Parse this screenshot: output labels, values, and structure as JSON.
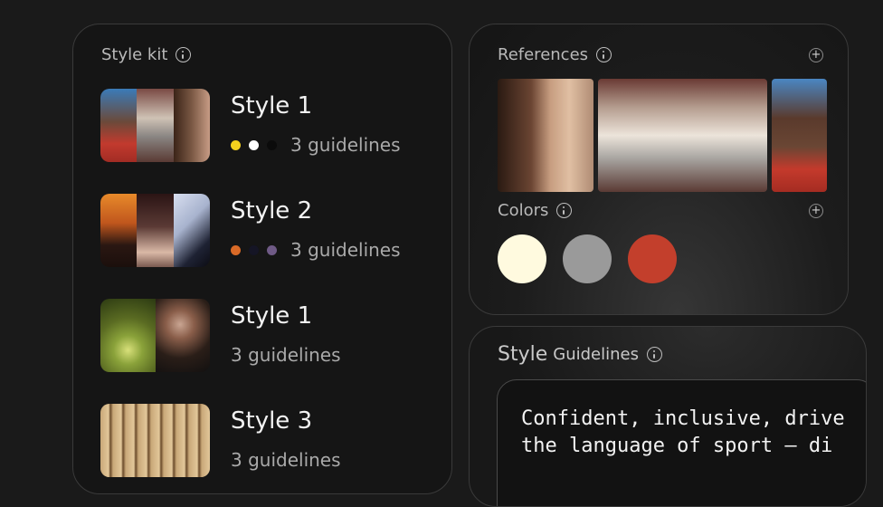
{
  "style_kit": {
    "title": "Style kit",
    "items": [
      {
        "name": "Style 1",
        "guidelines": "3 guidelines",
        "dots": [
          "#f4d11e",
          "#ffffff",
          "#0b0b0b"
        ]
      },
      {
        "name": "Style 2",
        "guidelines": "3 guidelines",
        "dots": [
          "#d96a27",
          "#151525",
          "#6f5a86"
        ]
      },
      {
        "name": "Style 1",
        "guidelines": "3 guidelines",
        "dots": []
      },
      {
        "name": "Style 3",
        "guidelines": "3 guidelines",
        "dots": []
      }
    ]
  },
  "references": {
    "title": "References",
    "add_icon": "plus-icon"
  },
  "colors": {
    "title": "Colors",
    "swatches": [
      "#fffadf",
      "#9a9a9a",
      "#c33f2c"
    ]
  },
  "guidelines": {
    "title_bold": "Style",
    "title_rest": "Guidelines",
    "text_line1": "Confident, inclusive, drive",
    "text_line2": "the language of sport — di"
  }
}
